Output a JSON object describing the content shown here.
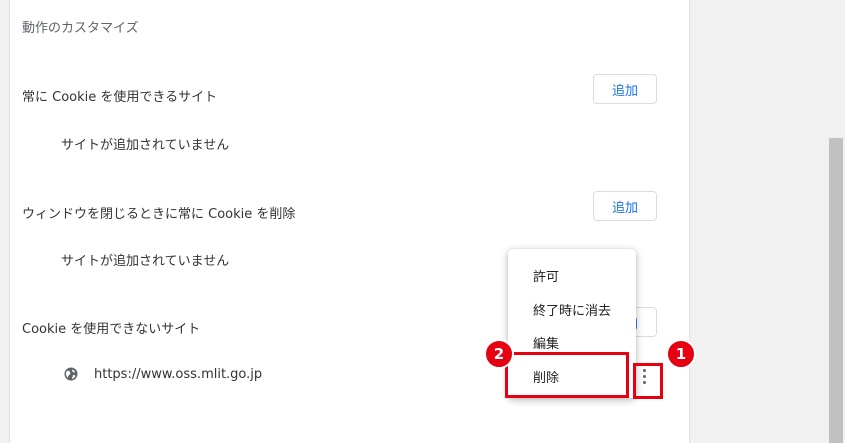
{
  "section_title": "動作のカスタマイズ",
  "allow_section": {
    "label": "常に Cookie を使用できるサイト",
    "add_label": "追加",
    "empty_text": "サイトが追加されていません"
  },
  "clear_on_exit_section": {
    "label": "ウィンドウを閉じるときに常に Cookie を削除",
    "add_label": "追加",
    "empty_text": "サイトが追加されていません"
  },
  "block_section": {
    "label": "Cookie を使用できないサイト",
    "add_label": "追加",
    "site": "https://www.oss.mlit.go.jp"
  },
  "context_menu": {
    "items": [
      "許可",
      "終了時に消去",
      "編集",
      "削除"
    ]
  },
  "annotations": {
    "step1": "1",
    "step2": "2",
    "color": "#e60012"
  },
  "icons": {
    "site_icon": "globe-icon",
    "more_icon": "more-vert-icon"
  }
}
